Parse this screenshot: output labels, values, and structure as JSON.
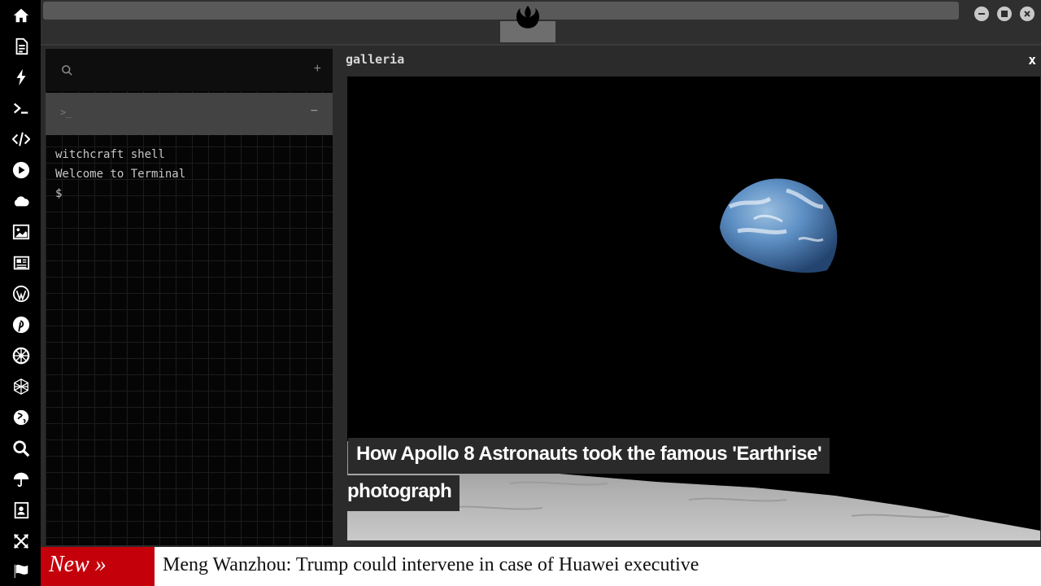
{
  "sidebar": {
    "icons": [
      "home-icon",
      "document-icon",
      "bolt-icon",
      "terminal-icon",
      "code-icon",
      "play-icon",
      "cloud-icon",
      "image-icon",
      "newspaper-icon",
      "wordpress-icon",
      "pinterest-icon",
      "empire-icon",
      "network-icon",
      "globe-icon",
      "search-icon",
      "umbrella-icon",
      "contact-icon",
      "expand-icon",
      "flag-icon"
    ]
  },
  "topbar": {
    "logo": "rebel-alliance-icon",
    "window_buttons": [
      "minimize",
      "maximize",
      "close"
    ]
  },
  "terminal": {
    "add_label": "+",
    "tab_prompt": ">_",
    "tab_minus": "−",
    "lines": [
      "witchcraft shell",
      "Welcome to Terminal",
      "$"
    ]
  },
  "gallery": {
    "title": "galleria",
    "close_label": "x",
    "caption_line1": "How Apollo 8 Astronauts took the famous 'Earthrise'",
    "caption_line2": "photograph"
  },
  "ticker": {
    "badge": "New »",
    "headline": "Meng Wanzhou: Trump could intervene in case of Huawei executive"
  },
  "colors": {
    "sidebar_bg": "#000000",
    "ticker_badge": "#c4000b",
    "panel_bg": "#2b2b2b"
  }
}
